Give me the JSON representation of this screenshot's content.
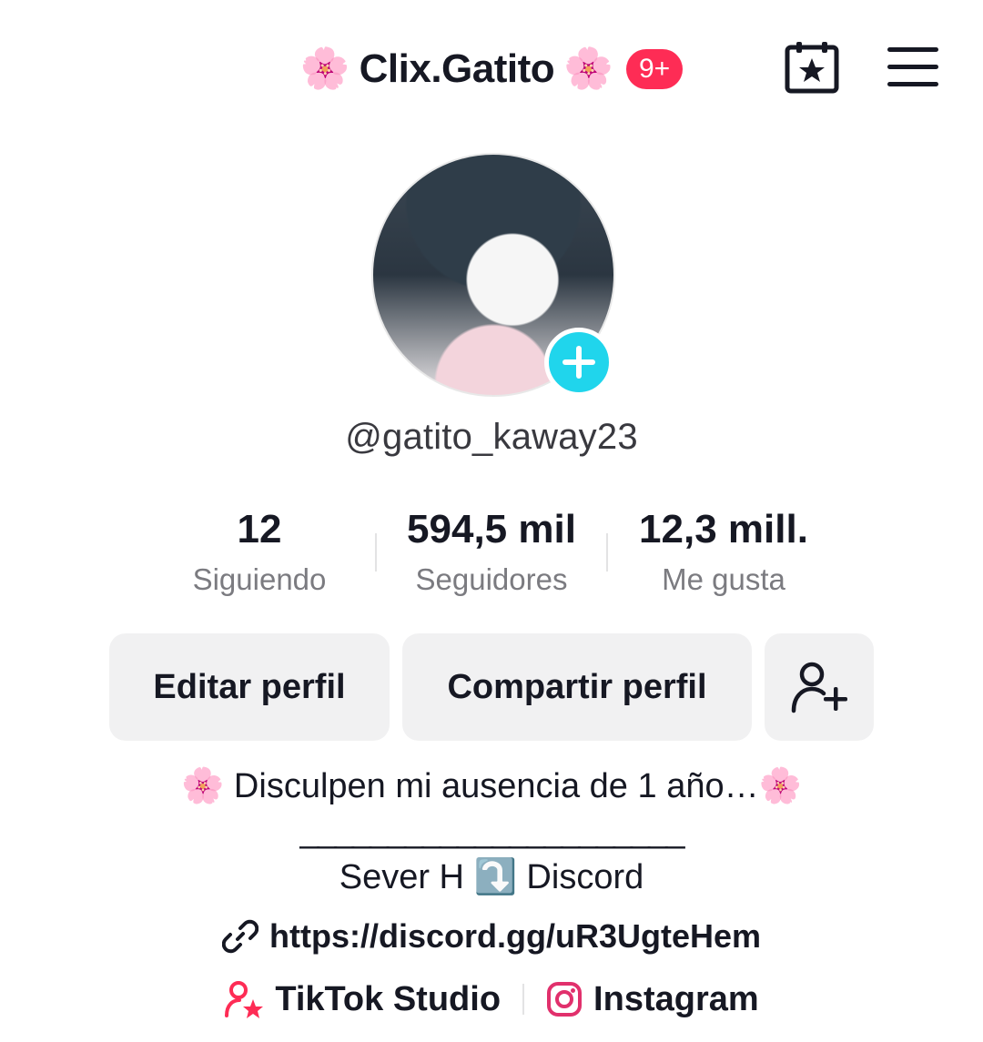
{
  "header": {
    "flower_left": "🌸",
    "title": "Clix.Gatito",
    "flower_right": "🌸",
    "badge": "9+",
    "accent": "#fe2c55"
  },
  "icons": {
    "calendar": "calendar-star-icon",
    "menu": "hamburger-menu-icon",
    "add": "plus-icon",
    "add_friend": "add-user-icon",
    "link": "link-icon",
    "studio": "tiktok-studio-icon",
    "instagram": "instagram-icon"
  },
  "profile": {
    "username": "@gatito_kaway23",
    "add_button_color": "#20d5ec"
  },
  "stats": [
    {
      "value": "12",
      "label": "Siguiendo"
    },
    {
      "value": "594,5 mil",
      "label": "Seguidores"
    },
    {
      "value": "12,3 mill.",
      "label": "Me gusta"
    }
  ],
  "actions": {
    "edit": "Editar perfil",
    "share": "Compartir perfil"
  },
  "bio": {
    "line1": "🌸 Disculpen mi ausencia de 1 año…🌸",
    "line2": "______________________",
    "line3": "Sever H ⤵️ Discord"
  },
  "link": {
    "url": "https://discord.gg/uR3UgteHem"
  },
  "bottom": {
    "studio": "TikTok Studio",
    "instagram": "Instagram"
  }
}
